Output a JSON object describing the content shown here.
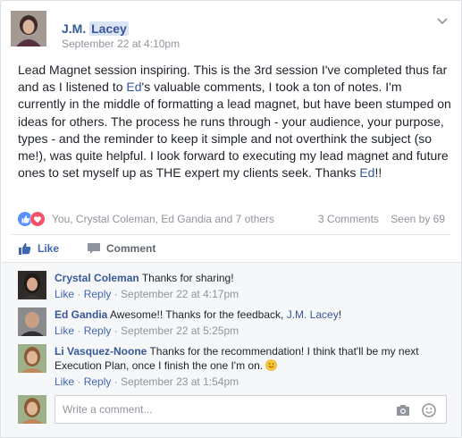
{
  "post": {
    "author": "J.M. ",
    "author_hl": "Lacey",
    "timestamp": "September 22 at 4:10pm",
    "text_parts": [
      "Lead Magnet session inspiring. This is the 3rd session I've completed thus far and as I listened to ",
      "Ed",
      "'s valuable comments, I took a ton of notes. I'm currently in the middle of formatting a lead magnet, but have been stumped on ideas for others. The process he runs through - your audience, your purpose, types - and the reminder to keep it simple and not overthink the subject (so me!), was quite helpful. I look forward to executing my lead magnet and future ones to set myself up as THE expert my clients seek. Thanks ",
      "Ed",
      "!!"
    ]
  },
  "summary": {
    "names": "You, Crystal Coleman, Ed Gandia and 7 others",
    "comments": "3 Comments",
    "seen": "Seen by 69"
  },
  "actions": {
    "like": "Like",
    "comment": "Comment"
  },
  "comments": [
    {
      "name": "Crystal Coleman",
      "text": " Thanks for sharing!",
      "like": "Like",
      "reply": "Reply",
      "time": "September 22 at 4:17pm"
    },
    {
      "name": "Ed Gandia",
      "text": " Awesome!! Thanks for the feedback, ",
      "mention": "J.M. Lacey",
      "text_end": "!",
      "like": "Like",
      "reply": "Reply",
      "time": "September 22 at 5:25pm"
    },
    {
      "name": "Li Vasquez-Noone",
      "text": " Thanks for the recommendation! I think that'll be my next Execution Plan, once I finish the one I'm on. ",
      "like": "Like",
      "reply": "Reply",
      "time": "September 23 at 1:54pm"
    }
  ],
  "composer": {
    "placeholder": "Write a comment..."
  },
  "sep": " · "
}
